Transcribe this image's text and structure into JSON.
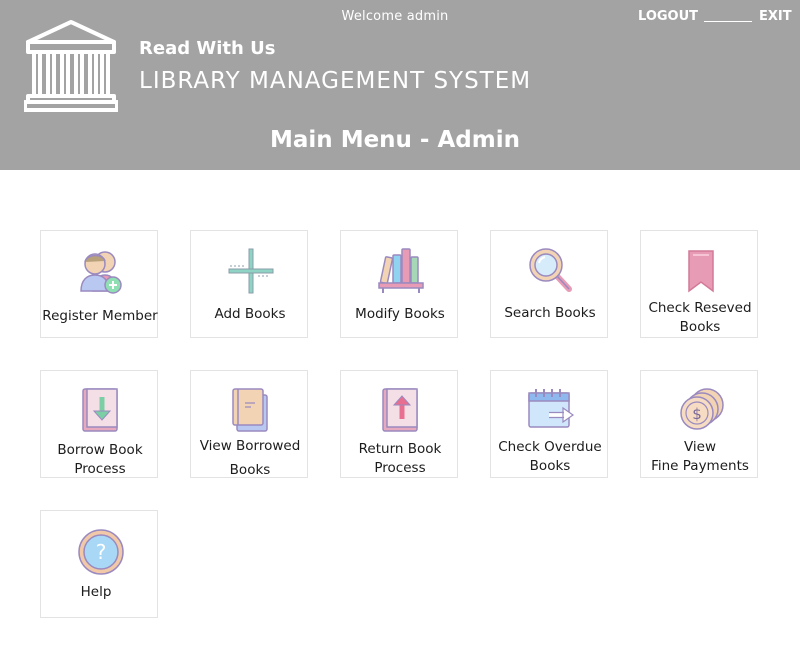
{
  "header": {
    "welcome": "Welcome admin",
    "logout_label": "LOGOUT",
    "exit_label": "EXIT",
    "brand": "Read With Us",
    "system_name": "LIBRARY MANAGEMENT SYSTEM",
    "menu_title": "Main Menu - Admin"
  },
  "colors": {
    "header_bg": "#a3a3a3",
    "icon_pink": "#e89bb5",
    "icon_blue": "#8fd3f0",
    "icon_tan": "#f2d4b4",
    "icon_outline": "#9a8abf"
  },
  "menu": {
    "items": [
      {
        "label": "Register Member",
        "icon": "add-user-icon"
      },
      {
        "label": "Add Books",
        "icon": "plus-crosshair-icon"
      },
      {
        "label": "Modify Books",
        "icon": "bookshelf-icon"
      },
      {
        "label": "Search Books",
        "icon": "magnifier-icon"
      },
      {
        "label": "Check Reseved\nBooks",
        "icon": "bookmark-icon"
      },
      {
        "label": "Borrow Book\nProcess",
        "icon": "book-down-arrow-icon"
      },
      {
        "label": "View Borrowed\nBooks",
        "icon": "stacked-books-icon"
      },
      {
        "label": "Return Book\nProcess",
        "icon": "book-up-arrow-icon"
      },
      {
        "label": "Check Overdue\nBooks",
        "icon": "calendar-arrow-icon"
      },
      {
        "label": "View\nFine Payments",
        "icon": "coins-icon"
      },
      {
        "label": "Help",
        "icon": "question-circle-icon"
      }
    ]
  }
}
